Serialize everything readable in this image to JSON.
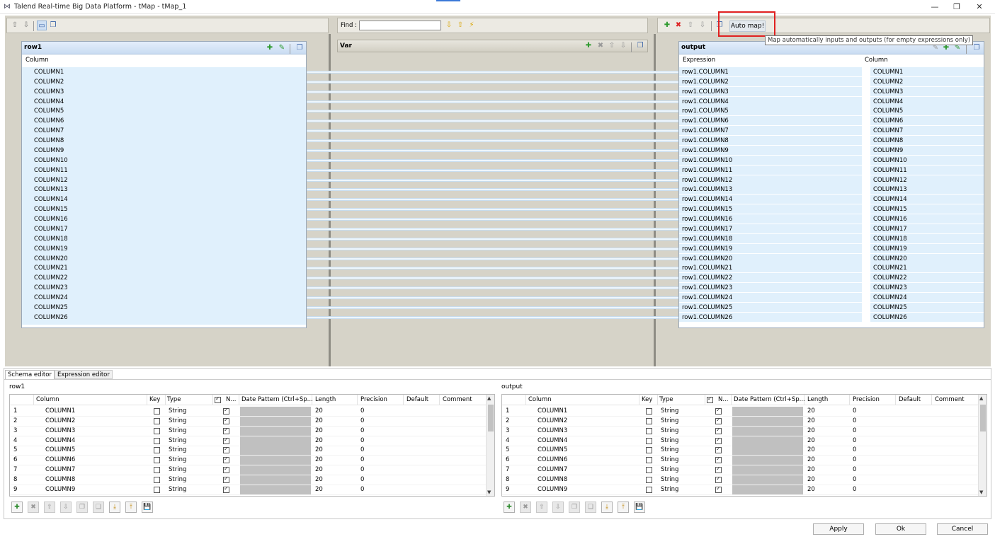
{
  "window": {
    "title": "Talend Real-time Big Data Platform - tMap - tMap_1",
    "minimize": "—",
    "restore": "❐",
    "close": "✕"
  },
  "find": {
    "label": "Find :",
    "value": ""
  },
  "input_table": {
    "name": "row1",
    "column_header": "Column",
    "columns": [
      "COLUMN1",
      "COLUMN2",
      "COLUMN3",
      "COLUMN4",
      "COLUMN5",
      "COLUMN6",
      "COLUMN7",
      "COLUMN8",
      "COLUMN9",
      "COLUMN10",
      "COLUMN11",
      "COLUMN12",
      "COLUMN13",
      "COLUMN14",
      "COLUMN15",
      "COLUMN16",
      "COLUMN17",
      "COLUMN18",
      "COLUMN19",
      "COLUMN20",
      "COLUMN21",
      "COLUMN22",
      "COLUMN23",
      "COLUMN24",
      "COLUMN25",
      "COLUMN26"
    ]
  },
  "var_table": {
    "name": "Var"
  },
  "output_table": {
    "name": "output",
    "expression_header": "Expression",
    "column_header": "Column",
    "expressions": [
      "row1.COLUMN1",
      "row1.COLUMN2",
      "row1.COLUMN3",
      "row1.COLUMN4",
      "row1.COLUMN5",
      "row1.COLUMN6",
      "row1.COLUMN7",
      "row1.COLUMN8",
      "row1.COLUMN9",
      "row1.COLUMN10",
      "row1.COLUMN11",
      "row1.COLUMN12",
      "row1.COLUMN13",
      "row1.COLUMN14",
      "row1.COLUMN15",
      "row1.COLUMN16",
      "row1.COLUMN17",
      "row1.COLUMN18",
      "row1.COLUMN19",
      "row1.COLUMN20",
      "row1.COLUMN21",
      "row1.COLUMN22",
      "row1.COLUMN23",
      "row1.COLUMN24",
      "row1.COLUMN25",
      "row1.COLUMN26"
    ],
    "columns": [
      "COLUMN1",
      "COLUMN2",
      "COLUMN3",
      "COLUMN4",
      "COLUMN5",
      "COLUMN6",
      "COLUMN7",
      "COLUMN8",
      "COLUMN9",
      "COLUMN10",
      "COLUMN11",
      "COLUMN12",
      "COLUMN13",
      "COLUMN14",
      "COLUMN15",
      "COLUMN16",
      "COLUMN17",
      "COLUMN18",
      "COLUMN19",
      "COLUMN20",
      "COLUMN21",
      "COLUMN22",
      "COLUMN23",
      "COLUMN24",
      "COLUMN25",
      "COLUMN26"
    ]
  },
  "automap": {
    "label": "Auto map!",
    "tooltip": "Map automatically inputs and outputs (for empty expressions only)"
  },
  "tabs": [
    "Schema editor",
    "Expression editor"
  ],
  "schema": {
    "headers": [
      "Column",
      "Key",
      "Type",
      "N...",
      "Date Pattern (Ctrl+Sp...",
      "Length",
      "Precision",
      "Default",
      "Comment"
    ],
    "left": {
      "label": "row1",
      "rows": [
        {
          "num": "1",
          "column": "COLUMN1",
          "type": "String",
          "length": "20",
          "precision": "0"
        },
        {
          "num": "2",
          "column": "COLUMN2",
          "type": "String",
          "length": "20",
          "precision": "0"
        },
        {
          "num": "3",
          "column": "COLUMN3",
          "type": "String",
          "length": "20",
          "precision": "0"
        },
        {
          "num": "4",
          "column": "COLUMN4",
          "type": "String",
          "length": "20",
          "precision": "0"
        },
        {
          "num": "5",
          "column": "COLUMN5",
          "type": "String",
          "length": "20",
          "precision": "0"
        },
        {
          "num": "6",
          "column": "COLUMN6",
          "type": "String",
          "length": "20",
          "precision": "0"
        },
        {
          "num": "7",
          "column": "COLUMN7",
          "type": "String",
          "length": "20",
          "precision": "0"
        },
        {
          "num": "8",
          "column": "COLUMN8",
          "type": "String",
          "length": "20",
          "precision": "0"
        },
        {
          "num": "9",
          "column": "COLUMN9",
          "type": "String",
          "length": "20",
          "precision": "0"
        }
      ]
    },
    "right": {
      "label": "output",
      "rows": [
        {
          "num": "1",
          "column": "COLUMN1",
          "type": "String",
          "length": "20",
          "precision": "0"
        },
        {
          "num": "2",
          "column": "COLUMN2",
          "type": "String",
          "length": "20",
          "precision": "0"
        },
        {
          "num": "3",
          "column": "COLUMN3",
          "type": "String",
          "length": "20",
          "precision": "0"
        },
        {
          "num": "4",
          "column": "COLUMN4",
          "type": "String",
          "length": "20",
          "precision": "0"
        },
        {
          "num": "5",
          "column": "COLUMN5",
          "type": "String",
          "length": "20",
          "precision": "0"
        },
        {
          "num": "6",
          "column": "COLUMN6",
          "type": "String",
          "length": "20",
          "precision": "0"
        },
        {
          "num": "7",
          "column": "COLUMN7",
          "type": "String",
          "length": "20",
          "precision": "0"
        },
        {
          "num": "8",
          "column": "COLUMN8",
          "type": "String",
          "length": "20",
          "precision": "0"
        },
        {
          "num": "9",
          "column": "COLUMN9",
          "type": "String",
          "length": "20",
          "precision": "0"
        }
      ]
    }
  },
  "buttons": {
    "apply": "Apply",
    "ok": "Ok",
    "cancel": "Cancel"
  },
  "icons": {
    "up": "⇧",
    "down": "⇩",
    "add": "✚",
    "remove": "✖",
    "edit": "✎",
    "filter": "▭",
    "find_down": "⇩",
    "find_up": "⇧",
    "find_clear": "⚡",
    "table_up": "⇧",
    "table_down": "⇩",
    "copy": "❐",
    "paste": "❏",
    "import": "⤓",
    "export": "⤒",
    "save": "💾",
    "scroll_up": "▲",
    "scroll_down": "▼",
    "window_icon": "⋈"
  },
  "colors": {
    "highlight": "#e02020",
    "panel_bg": "#d6d3c8",
    "selection": "#e0f0fc"
  }
}
